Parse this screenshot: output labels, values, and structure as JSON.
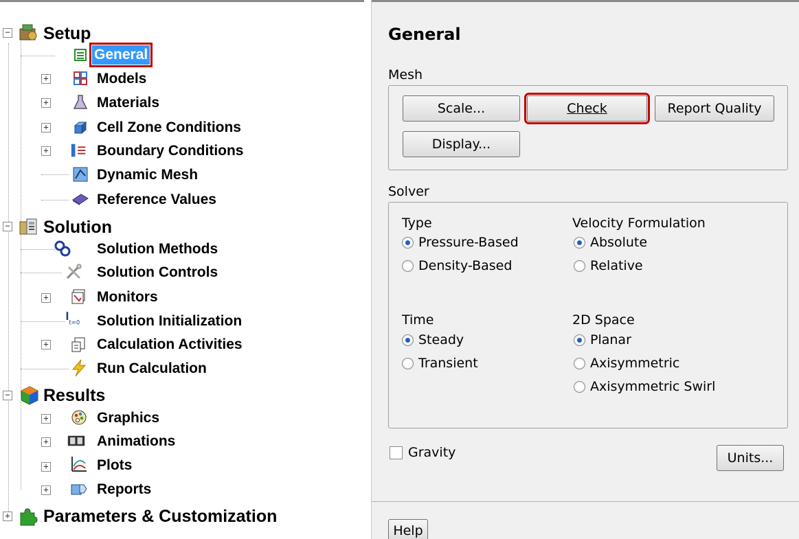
{
  "tree": {
    "setup": {
      "label": "Setup",
      "children": [
        {
          "label": "General",
          "icon": "general-icon",
          "selected": true
        },
        {
          "label": "Models",
          "icon": "models-icon"
        },
        {
          "label": "Materials",
          "icon": "flask-icon"
        },
        {
          "label": "Cell Zone Conditions",
          "icon": "cube-icon"
        },
        {
          "label": "Boundary Conditions",
          "icon": "boundary-icon"
        },
        {
          "label": "Dynamic Mesh",
          "icon": "dynamic-mesh-icon"
        },
        {
          "label": "Reference Values",
          "icon": "book-icon"
        }
      ]
    },
    "solution": {
      "label": "Solution",
      "children": [
        {
          "label": "Solution Methods",
          "icon": "methods-icon"
        },
        {
          "label": "Solution Controls",
          "icon": "tools-icon"
        },
        {
          "label": "Monitors",
          "icon": "monitor-icon"
        },
        {
          "label": "Solution Initialization",
          "icon": "init-icon"
        },
        {
          "label": "Calculation Activities",
          "icon": "activities-icon"
        },
        {
          "label": "Run Calculation",
          "icon": "lightning-icon"
        }
      ]
    },
    "results": {
      "label": "Results",
      "children": [
        {
          "label": "Graphics",
          "icon": "palette-icon"
        },
        {
          "label": "Animations",
          "icon": "film-icon"
        },
        {
          "label": "Plots",
          "icon": "plot-icon"
        },
        {
          "label": "Reports",
          "icon": "report-icon"
        }
      ]
    },
    "parameters": {
      "label": "Parameters & Customization"
    }
  },
  "panel": {
    "title": "General",
    "mesh": {
      "label": "Mesh",
      "scale": "Scale...",
      "check": "Check",
      "report_quality": "Report Quality",
      "display": "Display..."
    },
    "solver": {
      "label": "Solver",
      "type": {
        "label": "Type",
        "options": [
          "Pressure-Based",
          "Density-Based"
        ],
        "selected": "Pressure-Based"
      },
      "velocity": {
        "label": "Velocity Formulation",
        "options": [
          "Absolute",
          "Relative"
        ],
        "selected": "Absolute"
      },
      "time": {
        "label": "Time",
        "options": [
          "Steady",
          "Transient"
        ],
        "selected": "Steady"
      },
      "space": {
        "label": "2D Space",
        "options": [
          "Planar",
          "Axisymmetric",
          "Axisymmetric Swirl"
        ],
        "selected": "Planar"
      }
    },
    "gravity": {
      "label": "Gravity",
      "checked": false
    },
    "units": "Units...",
    "help": "Help"
  },
  "colors": {
    "selection": "#3399ff",
    "highlight_box": "#c00000",
    "radio_fill": "#1d5fbf",
    "panel_bg": "#f0f0f0"
  }
}
